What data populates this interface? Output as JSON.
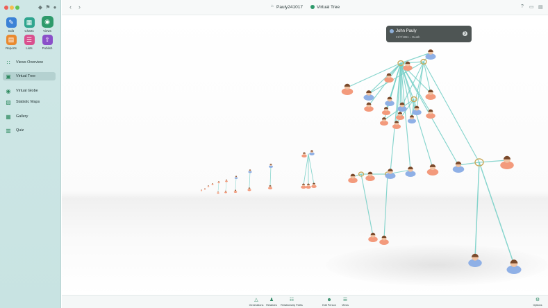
{
  "window": {
    "document_title": "Pauly241017",
    "view_title": "Virtual Tree"
  },
  "colors": {
    "accent_green": "#2e9a6b",
    "sidebar_bg": "#cfe7e6",
    "connector_teal": "#74cfc6",
    "male_shirt": "#8fb0e6",
    "female_shirt": "#f39a7c",
    "popover_bg": "#4e5554"
  },
  "toolbar": {
    "tools": [
      {
        "label": "Edit",
        "icon": "pencil-icon",
        "color": "#3b82d6"
      },
      {
        "label": "Charts",
        "icon": "charts-grid-icon",
        "color": "#2fa58e"
      },
      {
        "label": "Views",
        "icon": "eye-icon",
        "color": "#2e9a6b",
        "selected": true
      },
      {
        "label": "Reports",
        "icon": "report-icon",
        "color": "#e98a2f"
      },
      {
        "label": "Lists",
        "icon": "list-icon",
        "color": "#d9508e"
      },
      {
        "label": "Publish",
        "icon": "publish-icon",
        "color": "#8a4fc9"
      }
    ]
  },
  "sidebar": {
    "items": [
      {
        "label": "Views Overview",
        "icon": "views-overview-icon"
      },
      {
        "label": "Virtual Tree",
        "icon": "virtual-tree-icon",
        "active": true
      },
      {
        "label": "Virtual Globe",
        "icon": "globe-icon"
      },
      {
        "label": "Statistic Maps",
        "icon": "map-icon"
      },
      {
        "label": "Gallery",
        "icon": "gallery-icon"
      },
      {
        "label": "Quiz",
        "icon": "quiz-icon"
      }
    ]
  },
  "popover": {
    "name": "John Pauly",
    "dates": "21/7/1851 – Death"
  },
  "bottombar": {
    "items": [
      {
        "label": "Generations",
        "icon": "generations-icon"
      },
      {
        "label": "Relatives",
        "icon": "relatives-icon"
      },
      {
        "label": "Relationship Paths",
        "icon": "relationship-paths-icon"
      },
      {
        "label": "Edit Person",
        "icon": "edit-person-icon"
      },
      {
        "label": "Views",
        "icon": "views-icon"
      },
      {
        "label": "Options",
        "icon": "options-icon"
      }
    ]
  }
}
